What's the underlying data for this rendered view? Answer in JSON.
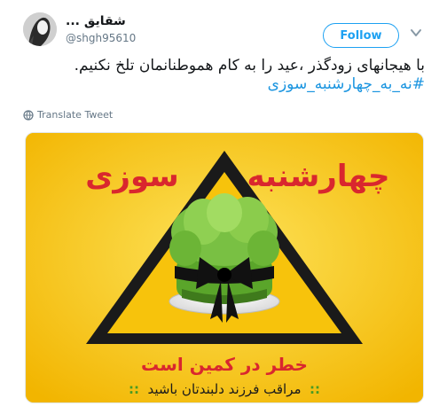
{
  "tweet": {
    "display_name": "شقایق ...",
    "handle": "@shgh95610",
    "follow_label": "Follow",
    "text_line1": "با هیجانهای زودگذر ،عید را به کام هموطنانمان تلخ نکنیم.",
    "hashtag": "#نه_به_چهارشنبه_سوزی",
    "translate_label": "Translate Tweet"
  },
  "poster": {
    "title_word1": "چهارشنبه",
    "title_word2": "سوزی",
    "warning": "خطر در کمین است",
    "subtitle": "مراقب فرزند دلبندتان باشید",
    "bullet_left": "::",
    "bullet_right": "::"
  },
  "colors": {
    "accent": "#1da1f2",
    "poster_bg": "#f7c30c",
    "poster_red": "#d9272e",
    "triangle_black": "#1a1a1a"
  },
  "icons": {
    "chevron": "chevron-down-icon",
    "globe": "globe-icon"
  }
}
